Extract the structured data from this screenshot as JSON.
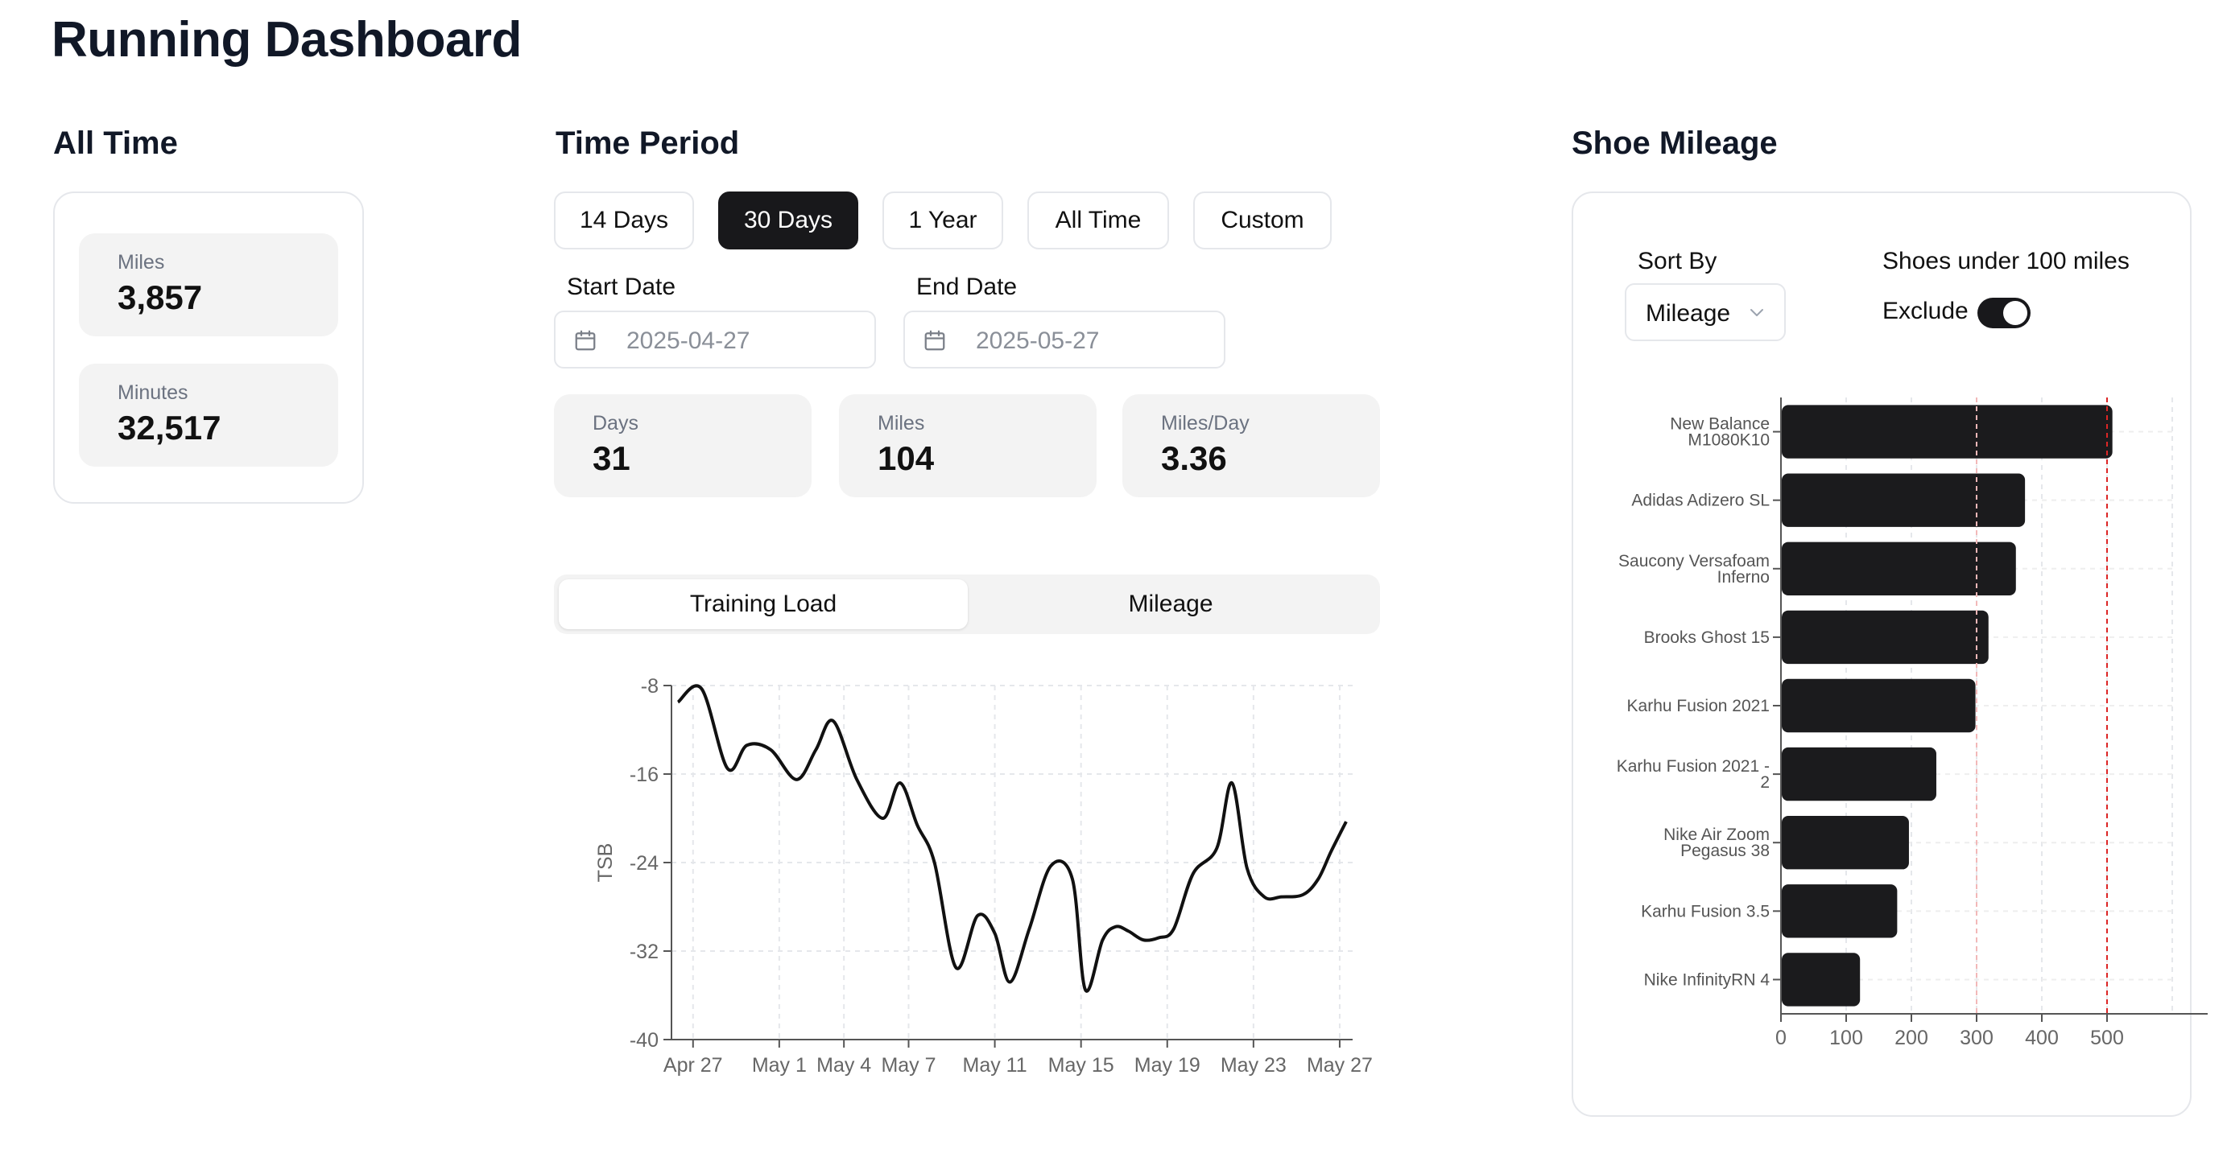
{
  "page": {
    "title": "Running Dashboard"
  },
  "all_time": {
    "title": "All Time",
    "stats": [
      {
        "label": "Miles",
        "value": "3,857"
      },
      {
        "label": "Minutes",
        "value": "32,517"
      }
    ]
  },
  "time_period": {
    "title": "Time Period",
    "options": [
      "14 Days",
      "30 Days",
      "1 Year",
      "All Time",
      "Custom"
    ],
    "selected": "30 Days",
    "start_label": "Start Date",
    "start_value": "2025-04-27",
    "end_label": "End Date",
    "end_value": "2025-05-27",
    "stats": [
      {
        "label": "Days",
        "value": "31"
      },
      {
        "label": "Miles",
        "value": "104"
      },
      {
        "label": "Miles/Day",
        "value": "3.36"
      }
    ]
  },
  "chart_tabs": {
    "tabs": [
      "Training Load",
      "Mileage"
    ],
    "active": "Training Load"
  },
  "shoe_mileage": {
    "title": "Shoe Mileage",
    "sort_label": "Sort By",
    "sort_value": "Mileage",
    "filter_label": "Shoes under 100 miles",
    "exclude_label": "Exclude",
    "exclude_on": true
  },
  "colors": {
    "primary": "#18181b",
    "tile_bg": "#f3f3f3",
    "border": "#e5e7eb",
    "threshold": "#dc2626"
  },
  "chart_data": [
    {
      "type": "line",
      "ylabel": "TSB",
      "xlabel": "",
      "ylim": [
        -40,
        -8
      ],
      "yticks": [
        -8,
        -16,
        -24,
        -32,
        -40
      ],
      "xticks": [
        "Apr 27",
        "May 1",
        "May 4",
        "May 7",
        "May 11",
        "May 15",
        "May 19",
        "May 23",
        "May 27"
      ],
      "xtick_days": [
        0,
        4,
        7,
        10,
        14,
        18,
        22,
        26,
        30
      ],
      "grid": true,
      "series": [
        {
          "x": [
            -0.7,
            0.4,
            1.6,
            2.5,
            3.6,
            4.8,
            5.7,
            6.5,
            7.6,
            8.8,
            9.6,
            10.4,
            11.2,
            12.2,
            13.2,
            14.0,
            14.7,
            15.6,
            16.6,
            17.6,
            18.2,
            19.0,
            19.6,
            20.2,
            20.9,
            21.6,
            22.3,
            23.2,
            24.3,
            25.0,
            25.7,
            26.5,
            27.3,
            28.3,
            29.0,
            29.6,
            30.3
          ],
          "y": [
            -9.5,
            -8.3,
            -15.5,
            -13.4,
            -13.8,
            -16.5,
            -13.8,
            -11.2,
            -16.5,
            -20.0,
            -16.8,
            -20.6,
            -24.0,
            -33.5,
            -28.8,
            -30.4,
            -34.8,
            -30.0,
            -24.3,
            -25.5,
            -35.5,
            -31.0,
            -29.8,
            -30.2,
            -31.0,
            -30.8,
            -30.0,
            -25.0,
            -22.7,
            -16.8,
            -24.5,
            -27.1,
            -27.1,
            -26.9,
            -25.5,
            -23.0,
            -20.3
          ]
        }
      ]
    },
    {
      "type": "bar",
      "orientation": "horizontal",
      "categories": [
        "New Balance M1080K10",
        "Adidas Adizero SL",
        "Saucony Versafoam Inferno",
        "Brooks Ghost 15",
        "Karhu Fusion 2021",
        "Karhu Fusion 2021 - 2",
        "Nike Air Zoom Pegasus 38",
        "Karhu Fusion 3.5",
        "Nike InfinityRN 4"
      ],
      "category_lines": [
        [
          "New Balance",
          "M1080K10"
        ],
        [
          "Adidas Adizero SL"
        ],
        [
          "Saucony Versafoam",
          "Inferno"
        ],
        [
          "Brooks Ghost 15"
        ],
        [
          "Karhu Fusion 2021"
        ],
        [
          "Karhu Fusion 2021 -",
          "2"
        ],
        [
          "Nike Air Zoom",
          "Pegasus 38"
        ],
        [
          "Karhu Fusion 3.5"
        ],
        [
          "Nike InfinityRN 4"
        ]
      ],
      "values": [
        507,
        373,
        359,
        317,
        297,
        237,
        195,
        177,
        120
      ],
      "xlim": [
        0,
        600
      ],
      "xticks": [
        0,
        100,
        200,
        300,
        400,
        500
      ],
      "reference_lines": [
        300,
        500
      ],
      "grid": true
    }
  ]
}
